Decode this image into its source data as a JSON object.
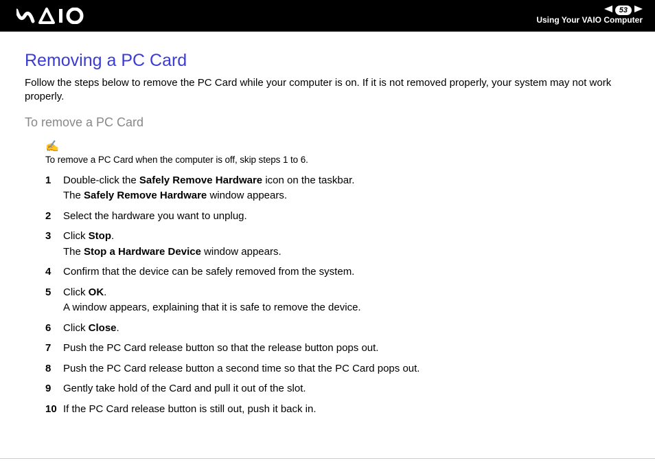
{
  "header": {
    "page_number": "53",
    "section": "Using Your VAIO Computer"
  },
  "title": "Removing a PC Card",
  "intro": "Follow the steps below to remove the PC Card while your computer is on. If it is not removed properly, your system may not work properly.",
  "subtitle": "To remove a PC Card",
  "note": "To remove a PC Card when the computer is off, skip steps 1 to 6.",
  "steps": [
    {
      "n": "1",
      "html": "Double-click the <b>Safely Remove Hardware</b> icon on the taskbar.<br>The <b>Safely Remove Hardware</b> window appears."
    },
    {
      "n": "2",
      "html": "Select the hardware you want to unplug."
    },
    {
      "n": "3",
      "html": "Click <b>Stop</b>.<br>The <b>Stop a Hardware Device</b> window appears."
    },
    {
      "n": "4",
      "html": "Confirm that the device can be safely removed from the system."
    },
    {
      "n": "5",
      "html": "Click <b>OK</b>.<br>A window appears, explaining that it is safe to remove the device."
    },
    {
      "n": "6",
      "html": "Click <b>Close</b>."
    },
    {
      "n": "7",
      "html": "Push the PC Card release button so that the release button pops out."
    },
    {
      "n": "8",
      "html": "Push the PC Card release button a second time so that the PC Card pops out."
    },
    {
      "n": "9",
      "html": "Gently take hold of the Card and pull it out of the slot."
    },
    {
      "n": "10",
      "html": "If the PC Card release button is still out, push it back in."
    }
  ]
}
